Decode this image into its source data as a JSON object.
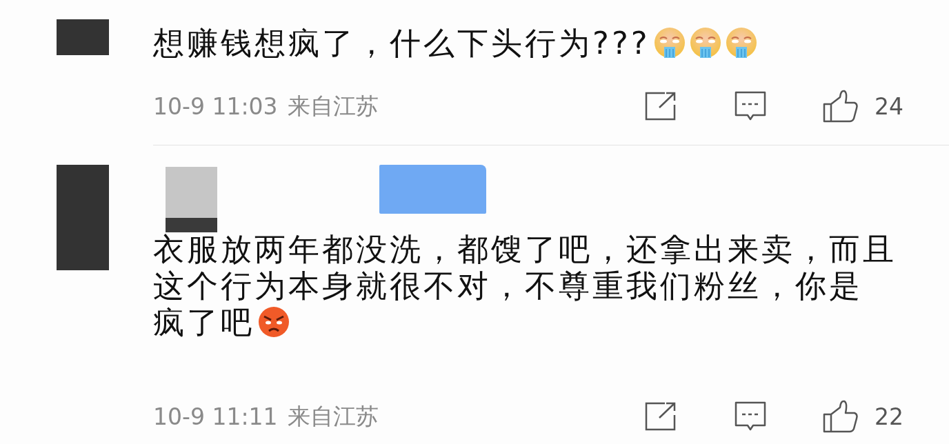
{
  "comments": [
    {
      "lines": [
        "想赚钱想疯了，什么下头行为???"
      ],
      "emojis": [
        {
          "kind": "drool"
        },
        {
          "kind": "drool"
        },
        {
          "kind": "drool"
        }
      ],
      "redacted_header": false,
      "date": "10-9 11:03",
      "location": "来自江苏",
      "likes": "24"
    },
    {
      "lines": [
        "衣服放两年都没洗，都馊了吧，还拿出来卖，而且",
        "这个行为本身就很不对，不尊重我们粉丝，你是",
        "疯了吧"
      ],
      "emojis": [
        {
          "kind": "angry"
        }
      ],
      "redacted_header": true,
      "date": "10-9 11:11",
      "location": "来自江苏",
      "likes": "22"
    }
  ]
}
